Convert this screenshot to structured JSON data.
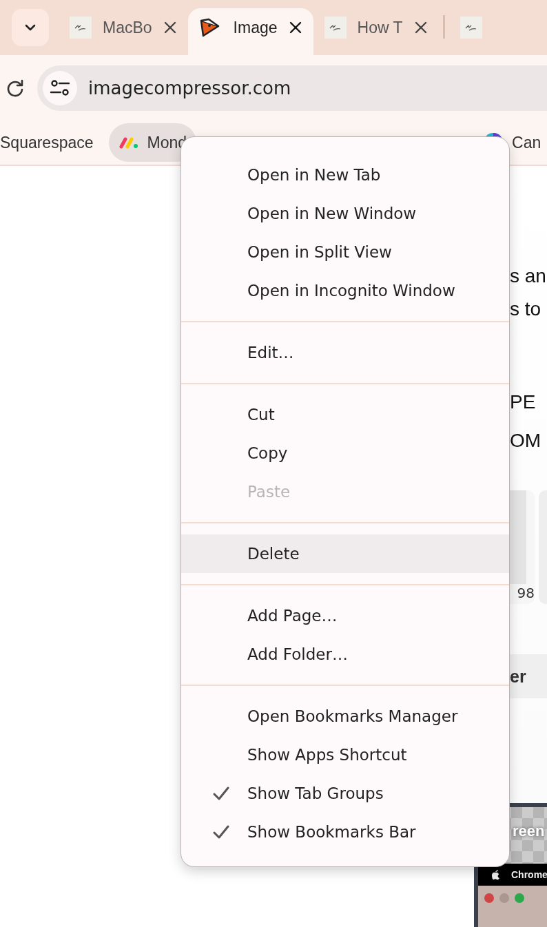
{
  "tabs": [
    {
      "title": "MacBo",
      "kind": "sketch",
      "selected": false
    },
    {
      "title": "Image",
      "kind": "bird",
      "selected": true
    },
    {
      "title": "How T",
      "kind": "sketch",
      "selected": false
    },
    {
      "kind": "sketch",
      "selected": false
    }
  ],
  "address": {
    "value": "imagecompressor.com"
  },
  "bookmarks": [
    {
      "label": "Squarespace",
      "selected": false
    },
    {
      "label": "Mond",
      "kind": "dots",
      "selected": true
    },
    {
      "label": "Can",
      "kind": "circle",
      "selected": false
    }
  ],
  "page": {
    "lines": [
      "s an",
      "s to",
      "PE",
      "OM"
    ],
    "card_caption": "98",
    "heading": "er",
    "thumbnail": {
      "title": "reen",
      "menu_label": "Chrome"
    }
  },
  "context_menu": {
    "groups": [
      [
        {
          "label": "Open in New Tab",
          "checked": false,
          "disabled": false,
          "selected": false
        },
        {
          "label": "Open in New Window",
          "checked": false,
          "disabled": false,
          "selected": false
        },
        {
          "label": "Open in Split View",
          "checked": false,
          "disabled": false,
          "selected": false
        },
        {
          "label": "Open in Incognito Window",
          "checked": false,
          "disabled": false,
          "selected": false
        }
      ],
      [
        {
          "label": "Edit…",
          "checked": false,
          "disabled": false,
          "selected": false
        }
      ],
      [
        {
          "label": "Cut",
          "checked": false,
          "disabled": false,
          "selected": false
        },
        {
          "label": "Copy",
          "checked": false,
          "disabled": false,
          "selected": false
        },
        {
          "label": "Paste",
          "checked": false,
          "disabled": true,
          "selected": false
        }
      ],
      [
        {
          "label": "Delete",
          "checked": false,
          "disabled": false,
          "selected": true
        }
      ],
      [
        {
          "label": "Add Page…",
          "checked": false,
          "disabled": false,
          "selected": false
        },
        {
          "label": "Add Folder…",
          "checked": false,
          "disabled": false,
          "selected": false
        }
      ],
      [
        {
          "label": "Open Bookmarks Manager",
          "checked": false,
          "disabled": false,
          "selected": false
        },
        {
          "label": "Show Apps Shortcut",
          "checked": false,
          "disabled": false,
          "selected": false
        },
        {
          "label": "Show Tab Groups",
          "checked": true,
          "disabled": false,
          "selected": false
        },
        {
          "label": "Show Bookmarks Bar",
          "checked": true,
          "disabled": false,
          "selected": false
        }
      ]
    ]
  }
}
